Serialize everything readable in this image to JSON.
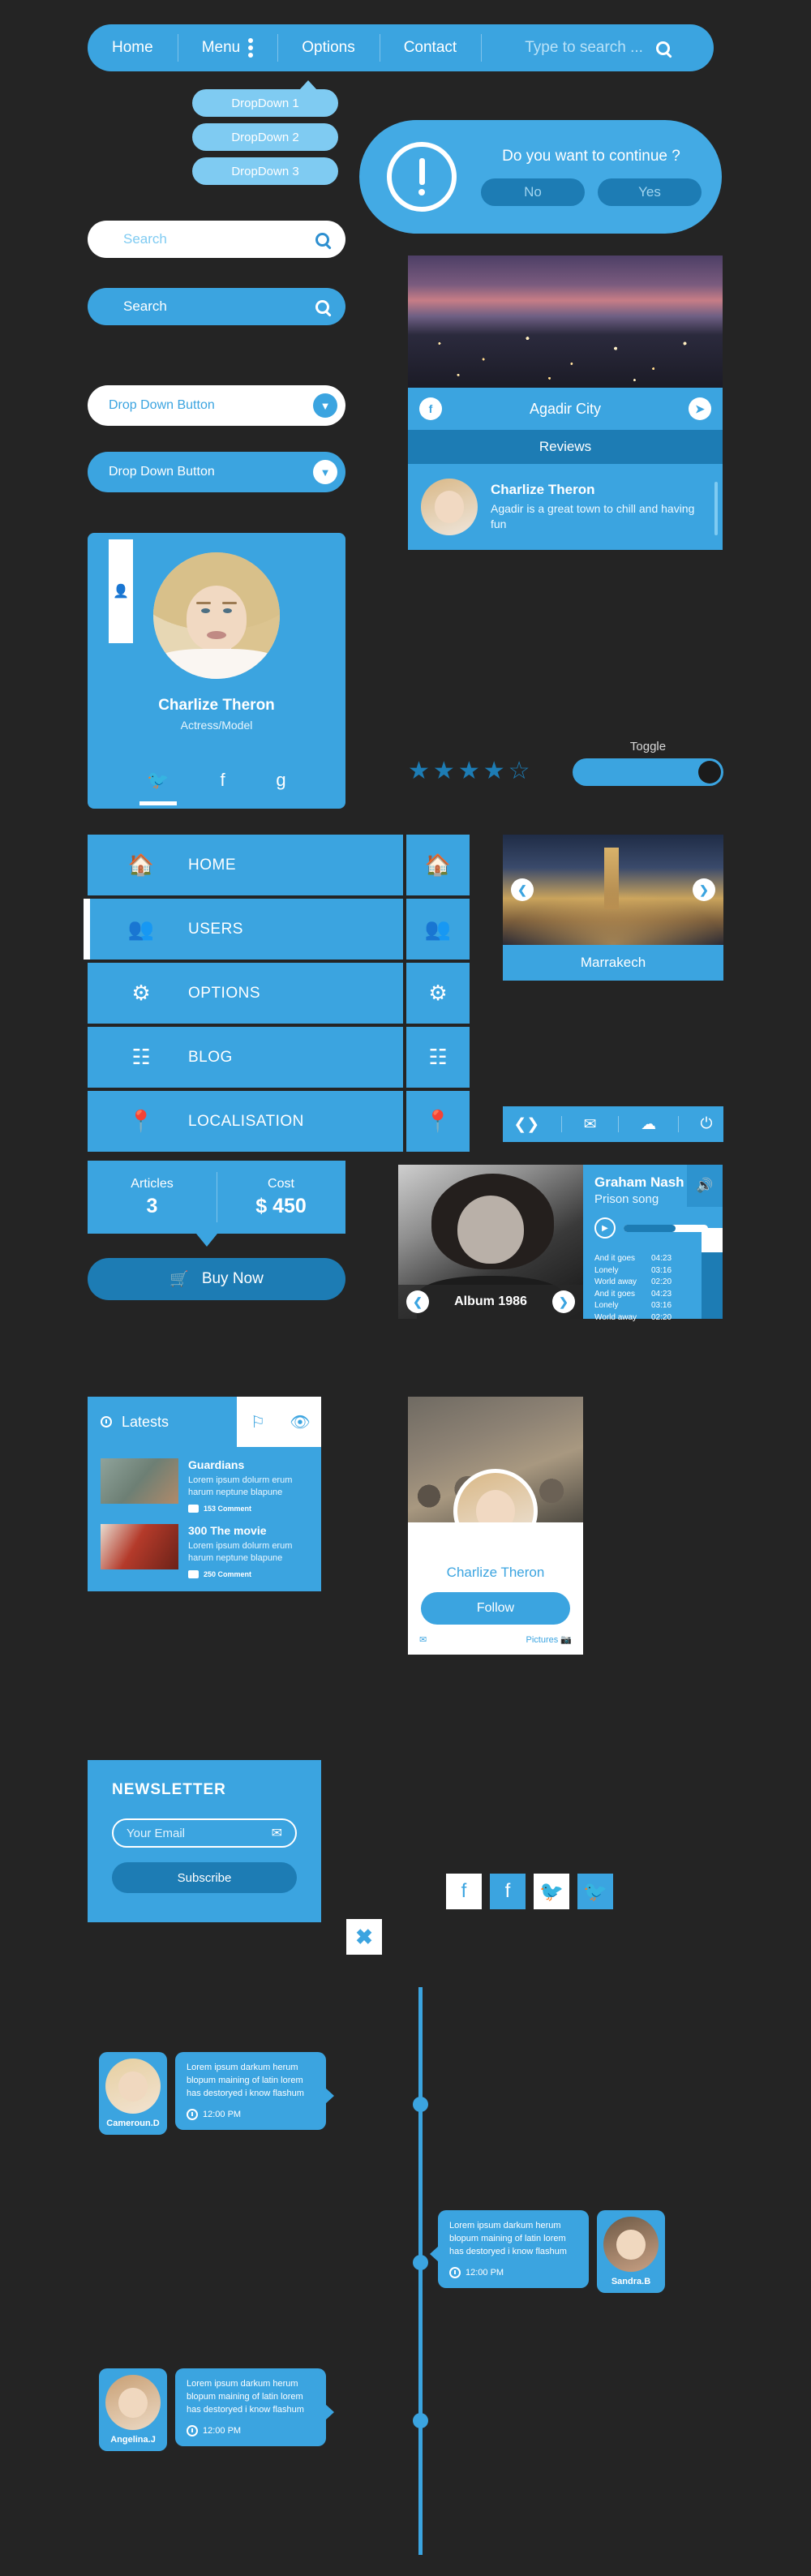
{
  "topnav": {
    "items": [
      "Home",
      "Menu",
      "Options",
      "Contact"
    ],
    "search_placeholder": "Type to search ...",
    "menu_icon": "kebab-icon",
    "search_icon": "search-icon"
  },
  "dropdown_bubbles": [
    "DropDown 1",
    "DropDown 2",
    "DropDown 3"
  ],
  "alert": {
    "icon": "exclamation-icon",
    "question": "Do you want to continue ?",
    "no_label": "No",
    "yes_label": "Yes"
  },
  "search_fields": [
    {
      "label": "Search",
      "style": "white"
    },
    {
      "label": "Search",
      "style": "blue"
    }
  ],
  "dropdown_buttons": [
    {
      "label": "Drop Down Button",
      "style": "white",
      "icon": "chevron-down-icon"
    },
    {
      "label": "Drop Down Button",
      "style": "blue",
      "icon": "chevron-down-icon"
    }
  ],
  "profile": {
    "tab_icon": "user-icon",
    "name": "Charlize Theron",
    "role": "Actress/Model",
    "socials": [
      "twitter-icon",
      "facebook-icon",
      "google-plus-icon"
    ]
  },
  "agadir": {
    "facebook_icon": "facebook-icon",
    "title": "Agadir City",
    "next_icon": "chevron-right-icon",
    "reviews_label": "Reviews",
    "review": {
      "author": "Charlize Theron",
      "text": "Agadir is a great town to chill and having fun"
    }
  },
  "rating": {
    "filled": 4,
    "total": 5,
    "toggle_label": "Toggle",
    "toggle_on": false
  },
  "menu": {
    "items": [
      {
        "label": "HOME",
        "icon": "home-icon",
        "active": false
      },
      {
        "label": "USERS",
        "icon": "users-icon",
        "active": true
      },
      {
        "label": "OPTIONS",
        "icon": "gear-icon",
        "active": false
      },
      {
        "label": "BLOG",
        "icon": "list-icon",
        "active": false
      },
      {
        "label": "LOCALISATION",
        "icon": "map-pin-icon",
        "active": false
      }
    ]
  },
  "marrakech": {
    "caption": "Marrakech",
    "prev_icon": "chevron-left-icon",
    "next_icon": "chevron-right-icon"
  },
  "iconbar": [
    "chevrons-icon",
    "inbox-icon",
    "cloud-icon",
    "power-icon"
  ],
  "stats": {
    "articles_label": "Articles",
    "articles_value": "3",
    "cost_label": "Cost",
    "cost_value": "$ 450",
    "buy_label": "Buy Now",
    "buy_icon": "cart-icon"
  },
  "player": {
    "artist": "Graham Nash",
    "song": "Prison song",
    "album": "Album 1986",
    "speaker_icon": "speaker-icon",
    "play_icon": "play-icon",
    "progress_percent": 62,
    "tracks": [
      {
        "title": "And it goes",
        "time": "04:23"
      },
      {
        "title": "Lonely",
        "time": "03:16"
      },
      {
        "title": "World away",
        "time": "02:20"
      },
      {
        "title": "And it goes",
        "time": "04:23"
      },
      {
        "title": "Lonely",
        "time": "03:16"
      },
      {
        "title": "World away",
        "time": "02:20"
      }
    ]
  },
  "latests": {
    "title": "Latests",
    "clock_icon": "clock-icon",
    "tabs": [
      "flag-icon",
      "eye-icon"
    ],
    "items": [
      {
        "title": "Guardians",
        "desc": "Lorem ipsum dolurm erum harum neptune blapune",
        "comments": "153 Comment"
      },
      {
        "title": "300 The movie",
        "desc": "Lorem ipsum dolurm erum harum neptune blapune",
        "comments": "250 Comment"
      }
    ]
  },
  "follow": {
    "name": "Charlize Theron",
    "button_label": "Follow",
    "mail_icon": "mail-icon",
    "pictures_label": "Pictures",
    "pictures_icon": "pictures-icon"
  },
  "newsletter": {
    "title": "NEWSLETTER",
    "email_placeholder": "Your Email",
    "mail_icon": "mail-icon",
    "subscribe_label": "Subscribe",
    "close_icon": "close-icon"
  },
  "social_buttons": [
    {
      "icon": "facebook-icon",
      "style": "white"
    },
    {
      "icon": "facebook-icon",
      "style": "blue"
    },
    {
      "icon": "twitter-icon",
      "style": "white"
    },
    {
      "icon": "twitter-icon",
      "style": "blue"
    }
  ],
  "timeline": [
    {
      "name": "Cameroun.D",
      "text": "Lorem ipsum darkum herum blopum maining of latin lorem has destoryed i know flashum",
      "time": "12:00 PM",
      "side": "left"
    },
    {
      "name": "Sandra.B",
      "text": "Lorem ipsum darkum herum blopum maining of latin lorem has destoryed i know flashum",
      "time": "12:00 PM",
      "side": "right"
    },
    {
      "name": "Angelina.J",
      "text": "Lorem ipsum darkum herum blopum maining of latin lorem has destoryed i know flashum",
      "time": "12:00 PM",
      "side": "left"
    }
  ],
  "colors": {
    "primary": "#3ba4e0",
    "primary_dark": "#1d7cb4",
    "primary_light": "#7fcbf2",
    "background": "#242424"
  }
}
